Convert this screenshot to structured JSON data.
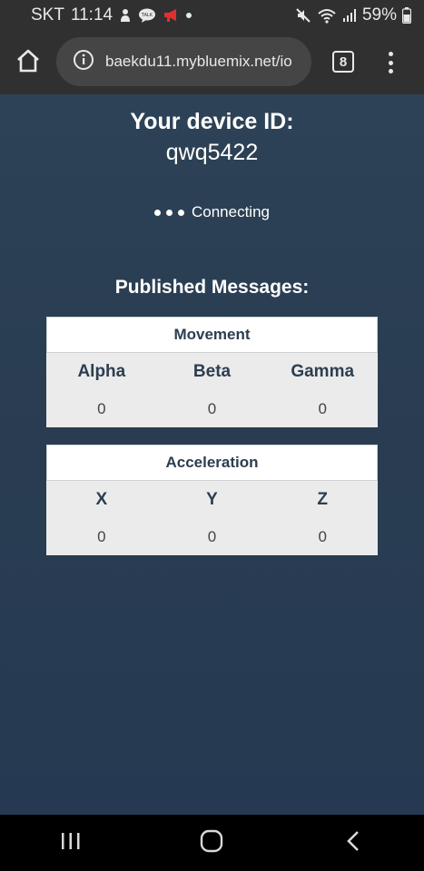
{
  "status_bar": {
    "carrier": "SKT",
    "time": "11:14",
    "battery": "59%",
    "icons": [
      "person-icon",
      "talk-icon",
      "megaphone-icon",
      "dot-icon",
      "mute-icon",
      "wifi-icon",
      "signal-icon",
      "battery-icon"
    ]
  },
  "browser": {
    "url": "baekdu11.mybluemix.net/io",
    "tab_count": "8",
    "icons": [
      "home-icon",
      "info-icon",
      "tabs-icon",
      "menu-icon"
    ]
  },
  "page": {
    "device_label": "Your device ID:",
    "device_id": "qwq5422",
    "connection_status": "Connecting",
    "published_title": "Published Messages:",
    "movement": {
      "title": "Movement",
      "headers": [
        "Alpha",
        "Beta",
        "Gamma"
      ],
      "values": [
        "0",
        "0",
        "0"
      ]
    },
    "acceleration": {
      "title": "Acceleration",
      "headers": [
        "X",
        "Y",
        "Z"
      ],
      "values": [
        "0",
        "0",
        "0"
      ]
    }
  },
  "nav": {
    "icons": [
      "recents-icon",
      "home-nav-icon",
      "back-icon"
    ]
  },
  "colors": {
    "background": "#2c3e50",
    "browser_chrome": "#303030",
    "table_bg": "#ebebeb",
    "table_text": "#2c3e50"
  }
}
